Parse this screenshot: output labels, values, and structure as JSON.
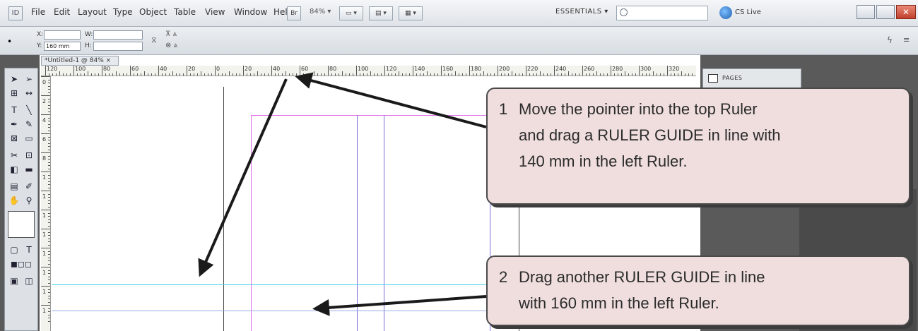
{
  "menubar": {
    "app_logo": "ID",
    "items": [
      "File",
      "Edit",
      "Layout",
      "Type",
      "Object",
      "Table",
      "View",
      "Window",
      "Help"
    ],
    "bridge_button": "Br",
    "zoom": "84% ▾",
    "workspace": "ESSENTIALS ▾",
    "search_placeholder": "",
    "cslive": "CS Live"
  },
  "controlbar": {
    "x_label": "X:",
    "y_label": "Y:",
    "y_value": "160 mm",
    "w_label": "W:",
    "h_label": "H:"
  },
  "document": {
    "tab_title": "*Untitled-1 @ 84% ×"
  },
  "rulers": {
    "top_ticks": [
      "120",
      "100",
      "80",
      "60",
      "40",
      "20",
      "0",
      "20",
      "40",
      "60",
      "80",
      "100",
      "120",
      "140",
      "160",
      "180",
      "200",
      "220",
      "240",
      "260",
      "280",
      "300",
      "320"
    ],
    "left_ticks": [
      "0",
      "2",
      "4",
      "6",
      "8",
      "1",
      "1",
      "1",
      "1",
      "1",
      "1",
      "1",
      "1"
    ]
  },
  "panels": {
    "pages_label": "PAGES"
  },
  "callouts": [
    {
      "number": "1",
      "lines": [
        "Move the pointer into the top Ruler",
        "and drag a RULER GUIDE in line with",
        "140 mm in the left Ruler."
      ]
    },
    {
      "number": "2",
      "lines": [
        "Drag another RULER GUIDE in line",
        "with 160 mm in the left Ruler."
      ]
    }
  ],
  "colors": {
    "guide_cyan": "#4fd3e6",
    "guide_blue": "#7a8fe0",
    "margin_magenta": "#e070e8",
    "column_purple": "#7a6fd8",
    "callout_bg": "#efdedd"
  }
}
